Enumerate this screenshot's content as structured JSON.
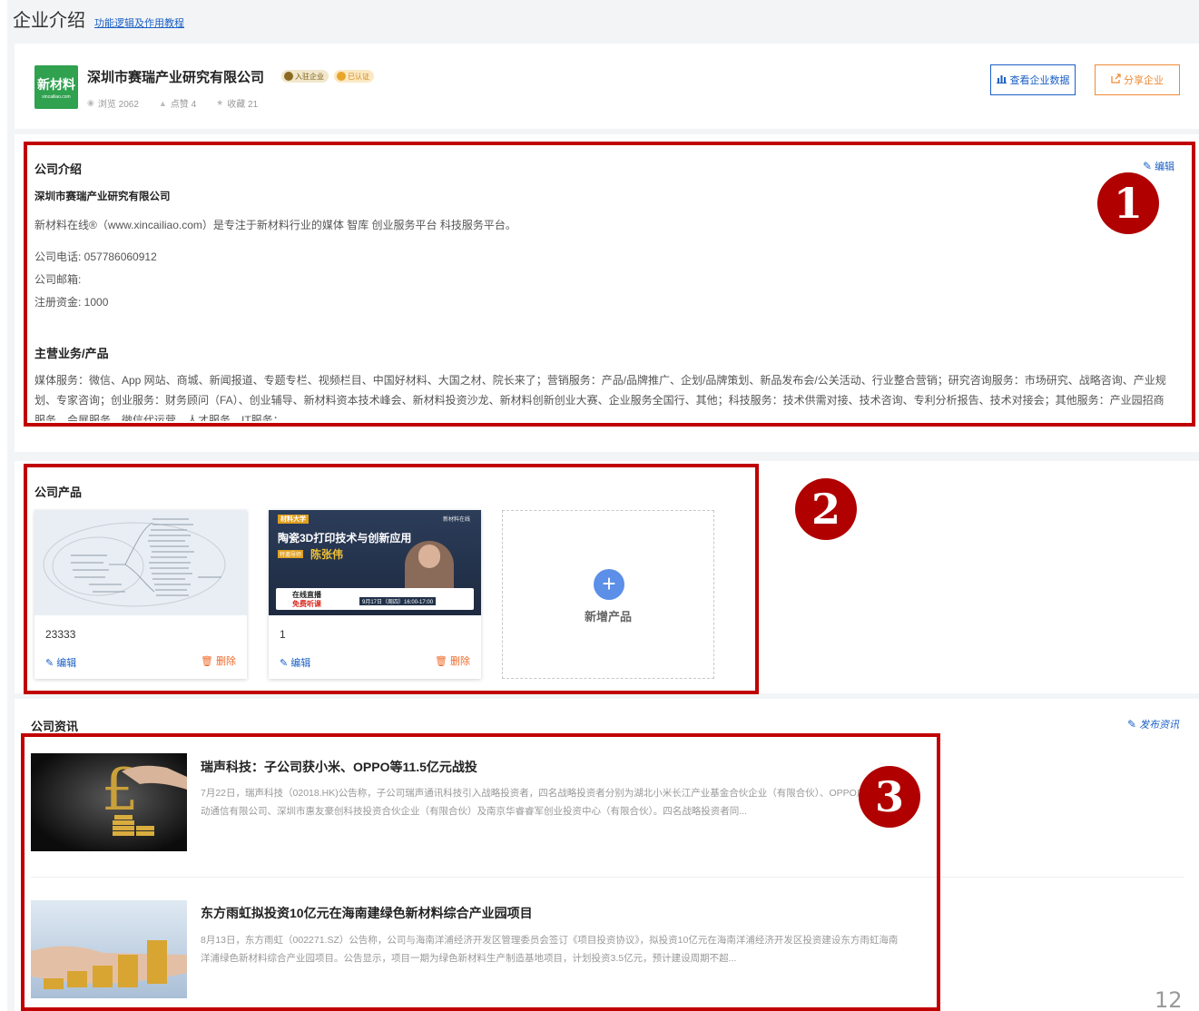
{
  "header": {
    "title": "企业介绍",
    "tutorial_link": "功能逻辑及作用教程"
  },
  "company": {
    "logo_main": "新材料",
    "logo_sub": "xincailiao.com",
    "name": "深圳市赛瑞产业研究有限公司",
    "badge_enterprise": "入驻企业",
    "badge_verified": "已认证",
    "stats": {
      "views": "浏览 2062",
      "likes": "点赞 4",
      "favorites": "收藏 21"
    },
    "btn_view_data": "查看企业数据",
    "btn_share": "分享企业"
  },
  "intro": {
    "section_title": "公司介绍",
    "edit_label": "编辑",
    "company_name": "深圳市赛瑞产业研究有限公司",
    "description": "新材料在线®（www.xincailiao.com）是专注于新材料行业的媒体 智库 创业服务平台 科技服务平台。",
    "phone": "公司电话:  057786060912",
    "email": "公司邮箱:",
    "capital": "注册资金:  1000",
    "business_title": "主营业务/产品",
    "business_text": "媒体服务：微信、App 网站、商城、新闻报道、专题专栏、视频栏目、中国好材料、大国之材、院长来了；营销服务：产品/品牌推广、企划/品牌策划、新品发布会/公关活动、行业整合营销；研究咨询服务：市场研究、战略咨询、产业规划、专家咨询；创业服务：财务顾问（FA）、创业辅导、新材料资本技术峰会、新材料投资沙龙、新材料创新创业大赛、企业服务全国行、其他；科技服务：技术供需对接、技术咨询、专利分析报告、技术对接会；其他服务：产业园招商服务、会展服务、微信代运营、人才服务、IT服务；",
    "annotation": "1"
  },
  "products": {
    "section_title": "公司产品",
    "items": [
      {
        "name": "23333",
        "edit": "编辑",
        "delete": "删除"
      },
      {
        "name": "1",
        "edit": "编辑",
        "delete": "删除"
      }
    ],
    "poster": {
      "tag": "材料大学",
      "brand": "新材料在线",
      "headline": "陶瓷3D打印技术与创新应用",
      "speaker": "陈张伟",
      "speaker_tag": "特邀导师",
      "live": "在线直播",
      "free": "免费听课",
      "time": "9月17日（周四）16:00-17:00"
    },
    "add_label": "新增产品",
    "annotation": "2"
  },
  "news": {
    "section_title": "公司资讯",
    "publish_label": "发布资讯",
    "items": [
      {
        "title": "瑞声科技：子公司获小米、OPPO等11.5亿元战投",
        "summary": "7月22日，瑞声科技（02018.HK)公告称，子公司瑞声通讯科技引入战略投资者，四名战略投资者分别为湖北小米长江产业基金合伙企业（有限合伙）、OPPO广东移动通信有限公司、深圳市惠友豪创科技投资合伙企业（有限合伙）及南京华睿睿军创业投资中心（有限合伙）。四名战略投资者同..."
      },
      {
        "title": "东方雨虹拟投资10亿元在海南建绿色新材料综合产业园项目",
        "summary": "8月13日，东方雨虹（002271.SZ）公告称，公司与海南洋浦经济开发区管理委员会签订《项目投资协议》，拟投资10亿元在海南洋浦经济开发区投资建设东方雨虹海南洋浦绿色新材料综合产业园项目。公告显示，项目一期为绿色新材料生产制造基地项目，计划投资3.5亿元，预计建设周期不超..."
      }
    ],
    "annotation": "3"
  },
  "page_number": "12"
}
